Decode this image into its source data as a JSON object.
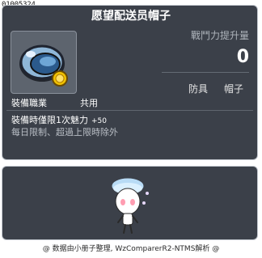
{
  "item": {
    "id": "01005324",
    "name": "愿望配送员帽子",
    "stat_label": "戰鬥力提升量",
    "stat_value": "0",
    "tags": [
      "防具",
      "帽子"
    ],
    "job_label": "裝備職業",
    "job_value": "共用",
    "effect_text": "裝備時僅限1次魅力",
    "effect_value": "+50",
    "description": "每日限制、超過上限時除外"
  },
  "footer": {
    "text": "@ 数据由小册子整理, WzComparerR2-NTMS解析 @"
  },
  "colors": {
    "panel_bg": "#3b4049",
    "panel_border": "#c3c8cf",
    "title": "#ffffff",
    "muted": "#aeb4bb"
  },
  "icons": {
    "item_icon": "helmet-icon",
    "preview": "avatar-preview"
  }
}
